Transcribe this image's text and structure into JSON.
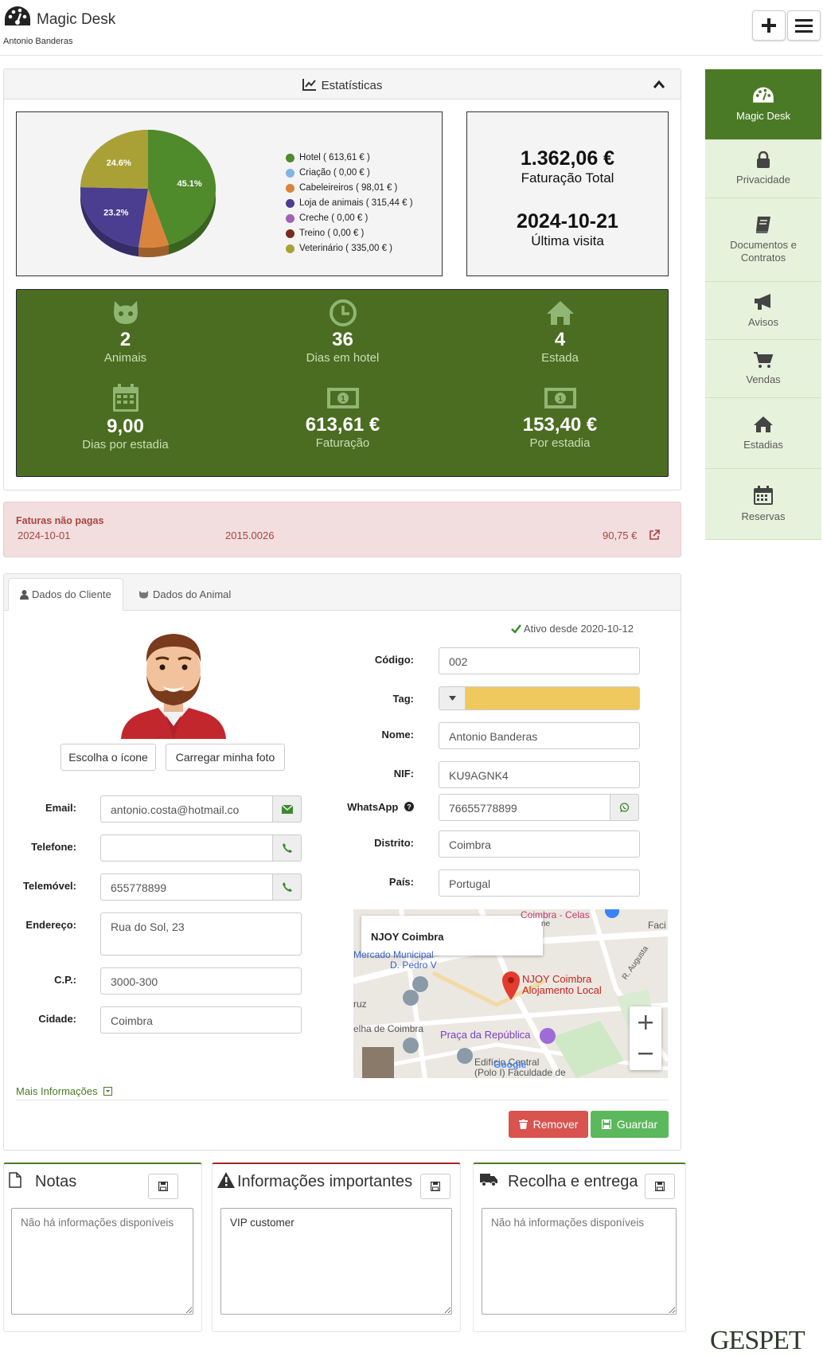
{
  "header": {
    "app_title": "Magic Desk",
    "user_name": "Antonio Banderas"
  },
  "sidebar": {
    "items": [
      {
        "label": "Magic Desk",
        "icon": "dashboard-icon"
      },
      {
        "label": "Privacidade",
        "icon": "lock-icon"
      },
      {
        "label": "Documentos e Contratos",
        "icon": "book-icon"
      },
      {
        "label": "Avisos",
        "icon": "megaphone-icon"
      },
      {
        "label": "Vendas",
        "icon": "cart-icon"
      },
      {
        "label": "Estadias",
        "icon": "home-icon"
      },
      {
        "label": "Reservas",
        "icon": "calendar-icon"
      }
    ]
  },
  "stats": {
    "title": "Estatísticas",
    "total_value": "1.362,06 €",
    "total_label": "Faturação Total",
    "last_visit_value": "2024-10-21",
    "last_visit_label": "Última visita",
    "green": [
      {
        "value": "2",
        "label": "Animais",
        "icon": "cat-icon"
      },
      {
        "value": "36",
        "label": "Dias em hotel",
        "icon": "clock-icon"
      },
      {
        "value": "4",
        "label": "Estada",
        "icon": "home-icon"
      },
      {
        "value": "9,00",
        "label": "Dias por estadia",
        "icon": "calendar-icon"
      },
      {
        "value": "613,61 €",
        "label": "Faturação",
        "icon": "money-icon"
      },
      {
        "value": "153,40 €",
        "label": "Por estadia",
        "icon": "money-icon"
      }
    ]
  },
  "chart_data": {
    "type": "pie",
    "categories": [
      "Hotel ( 613,61 € )",
      "Criação ( 0,00 € )",
      "Cabeleireiros ( 98,01 € )",
      "Loja de animais ( 315,44 € )",
      "Creche ( 0,00 € )",
      "Treino ( 0,00 € )",
      "Veterinário ( 335,00 € )"
    ],
    "values": [
      613.61,
      0.0,
      98.01,
      315.44,
      0.0,
      0.0,
      335.0
    ],
    "slice_labels": [
      "45.1%",
      "",
      "",
      "23.2%",
      "",
      "",
      "24.6%"
    ],
    "colors": [
      "#4f8a2b",
      "#7fb6e3",
      "#d9843c",
      "#4b3d8f",
      "#a261b5",
      "#7a2c1e",
      "#a9a136"
    ],
    "legend_position": "right"
  },
  "unpaid": {
    "title": "Faturas não pagas",
    "date": "2024-10-01",
    "number": "2015.0026",
    "amount": "90,75 €"
  },
  "tabs": [
    {
      "label": "Dados do Cliente"
    },
    {
      "label": "Dados do Animal"
    }
  ],
  "client": {
    "active_since": "Ativo desde 2020-10-12",
    "btn_choose_icon": "Escolha o ícone",
    "btn_upload_photo": "Carregar minha foto",
    "email_label": "Email:",
    "email": "antonio.costa@hotmail.co",
    "phone_label": "Telefone:",
    "phone": "",
    "mobile_label": "Telemóvel:",
    "mobile": "655778899",
    "address_label": "Endereço:",
    "address": "Rua do Sol, 23",
    "zip_label": "C.P.:",
    "zip": "3000-300",
    "city_label": "Cidade:",
    "city": "Coimbra",
    "code_label": "Código:",
    "code": "002",
    "tag_label": "Tag:",
    "tag_color": "#f0c95e",
    "name_label": "Nome:",
    "name": "Antonio Banderas",
    "nif_label": "NIF:",
    "nif": "KU9AGNK4",
    "whatsapp_label": "WhatsApp",
    "whatsapp": "76655778899",
    "district_label": "Distrito:",
    "district": "Coimbra",
    "country_label": "País:",
    "country": "Portugal",
    "more_info": "Mais Informações",
    "btn_remove": "Remover",
    "btn_save": "Guardar"
  },
  "map": {
    "info_title": "NJOY Coimbra",
    "pin_label_1": "NJOY Coimbra",
    "pin_label_2": "Alojamento Local",
    "labels": [
      "Coimbra - Celas",
      "Mercado Municipal",
      "D. Pedro V",
      "ruz",
      "elha de Coimbra",
      "Praça da República",
      "Edifício Central",
      "(Polo I) Faculdade de",
      "R. Augusta",
      "Faci",
      "ne"
    ],
    "google": "Google"
  },
  "cards": [
    {
      "title": "Notas",
      "value": "",
      "placeholder": "Não há informações disponíveis",
      "accent": "#4b7a27"
    },
    {
      "title": "Informações importantes",
      "value": "VIP customer",
      "placeholder": "",
      "accent": "#a62626"
    },
    {
      "title": "Recolha e entrega",
      "value": "",
      "placeholder": "Não há informações disponíveis",
      "accent": "#4b7a27"
    }
  ],
  "footer_logo": "GESPET"
}
